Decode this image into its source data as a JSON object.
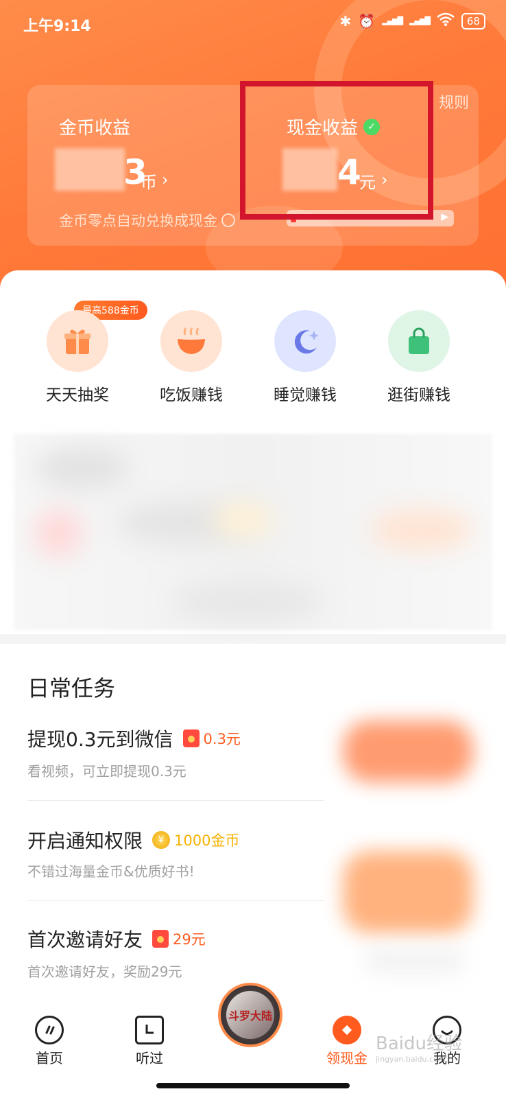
{
  "status_bar": {
    "time": "上午9:14",
    "battery": "68"
  },
  "earnings": {
    "rules_label": "规则",
    "coin": {
      "title": "金币收益",
      "value": "3",
      "unit": "币",
      "hint": "金币零点自动兑换成现金"
    },
    "cash": {
      "title": "现金收益",
      "value": "4",
      "unit": "元"
    }
  },
  "quick_actions": {
    "badge": "最高588金币",
    "items": [
      {
        "label": "天天抽奖",
        "icon": "gift-icon",
        "color": "#ffe3d3"
      },
      {
        "label": "吃饭赚钱",
        "icon": "bowl-icon",
        "color": "#ffe3d3"
      },
      {
        "label": "睡觉赚钱",
        "icon": "moon-icon",
        "color": "#dfe5ff"
      },
      {
        "label": "逛街赚钱",
        "icon": "bag-icon",
        "color": "#dff5e6"
      }
    ]
  },
  "daily_tasks": {
    "title": "日常任务",
    "items": [
      {
        "name": "提现0.3元到微信",
        "reward": "0.3元",
        "desc": "看视频，可立即提现0.3元"
      },
      {
        "name": "开启通知权限",
        "reward": "1000金币",
        "desc": "不错过海量金币&优质好书!"
      },
      {
        "name": "首次邀请好友",
        "reward": "29元",
        "desc": "首次邀请好友，奖励29元"
      }
    ]
  },
  "tab_bar": {
    "items": [
      {
        "label": "首页"
      },
      {
        "label": "听过"
      },
      {
        "label": "领现金"
      },
      {
        "label": "我的"
      }
    ],
    "center_cover_text": "斗罗大陆",
    "active_color": "#ff5b1e"
  },
  "watermark": {
    "brand": "Baidu经验",
    "url": "jingyan.baidu.com"
  }
}
